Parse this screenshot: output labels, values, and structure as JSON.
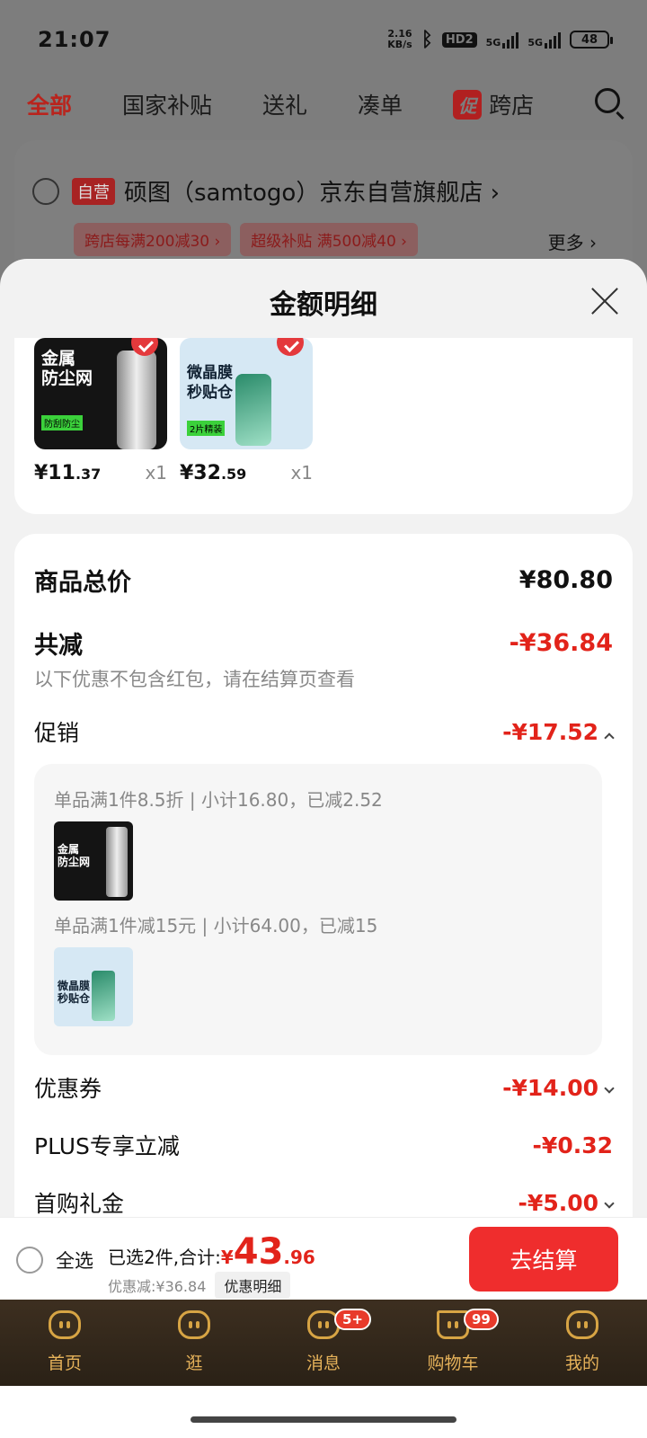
{
  "status_bar": {
    "time": "21:07",
    "net_speed_value": "2.16",
    "net_speed_unit": "KB/s",
    "hd": "HD2",
    "sig1": "5G",
    "sig2": "5G",
    "battery": "48"
  },
  "top_tabs": {
    "all": "全部",
    "subsidy": "国家补贴",
    "gift": "送礼",
    "bundle": "凑单",
    "promo_tag": "促",
    "cross": "跨店"
  },
  "store": {
    "self_tag": "自营",
    "name": "硕图（samtogo）京东自营旗舰店 ›",
    "chips": [
      "跨店每满200减30 ›",
      "超级补贴 满500减40 ›"
    ],
    "more": "更多 ›"
  },
  "sheet": {
    "title": "金额明细"
  },
  "products": [
    {
      "thumb_text": "金属\n防尘网",
      "thumb_tag": "防刮防尘",
      "price_int": "¥11",
      "price_dec": ".37",
      "qty": "x1"
    },
    {
      "thumb_text": "微晶膜\n秒贴仓",
      "thumb_tag": "2片精装",
      "price_int": "¥32",
      "price_dec": ".59",
      "qty": "x1"
    }
  ],
  "detail": {
    "total_label": "商品总价",
    "total_value": "¥80.80",
    "reduce_label": "共减",
    "reduce_value": "-¥36.84",
    "note": "以下优惠不包含红包，请在结算页查看",
    "promo_label": "促销",
    "promo_value": "-¥17.52",
    "promo_lines": [
      "单品满1件8.5折 | 小计16.80，已减2.52",
      "单品满1件减15元 | 小计64.00，已减15"
    ],
    "coupon_label": "优惠券",
    "coupon_value": "-¥14.00",
    "plus_label": "PLUS专享立减",
    "plus_value": "-¥0.32",
    "first_label": "首购礼金",
    "first_value": "-¥5.00"
  },
  "bottom": {
    "select_all": "全选",
    "selected_prefix": "已选2件,合计:",
    "currency": "¥",
    "total_int": "43",
    "total_dec": ".96",
    "discount": "优惠减:¥36.84",
    "detail_btn": "优惠明细",
    "checkout": "去结算"
  },
  "nav": [
    {
      "label": "首页",
      "badge": ""
    },
    {
      "label": "逛",
      "badge": ""
    },
    {
      "label": "消息",
      "badge": "5+"
    },
    {
      "label": "购物车",
      "badge": "99"
    },
    {
      "label": "我的",
      "badge": ""
    }
  ]
}
